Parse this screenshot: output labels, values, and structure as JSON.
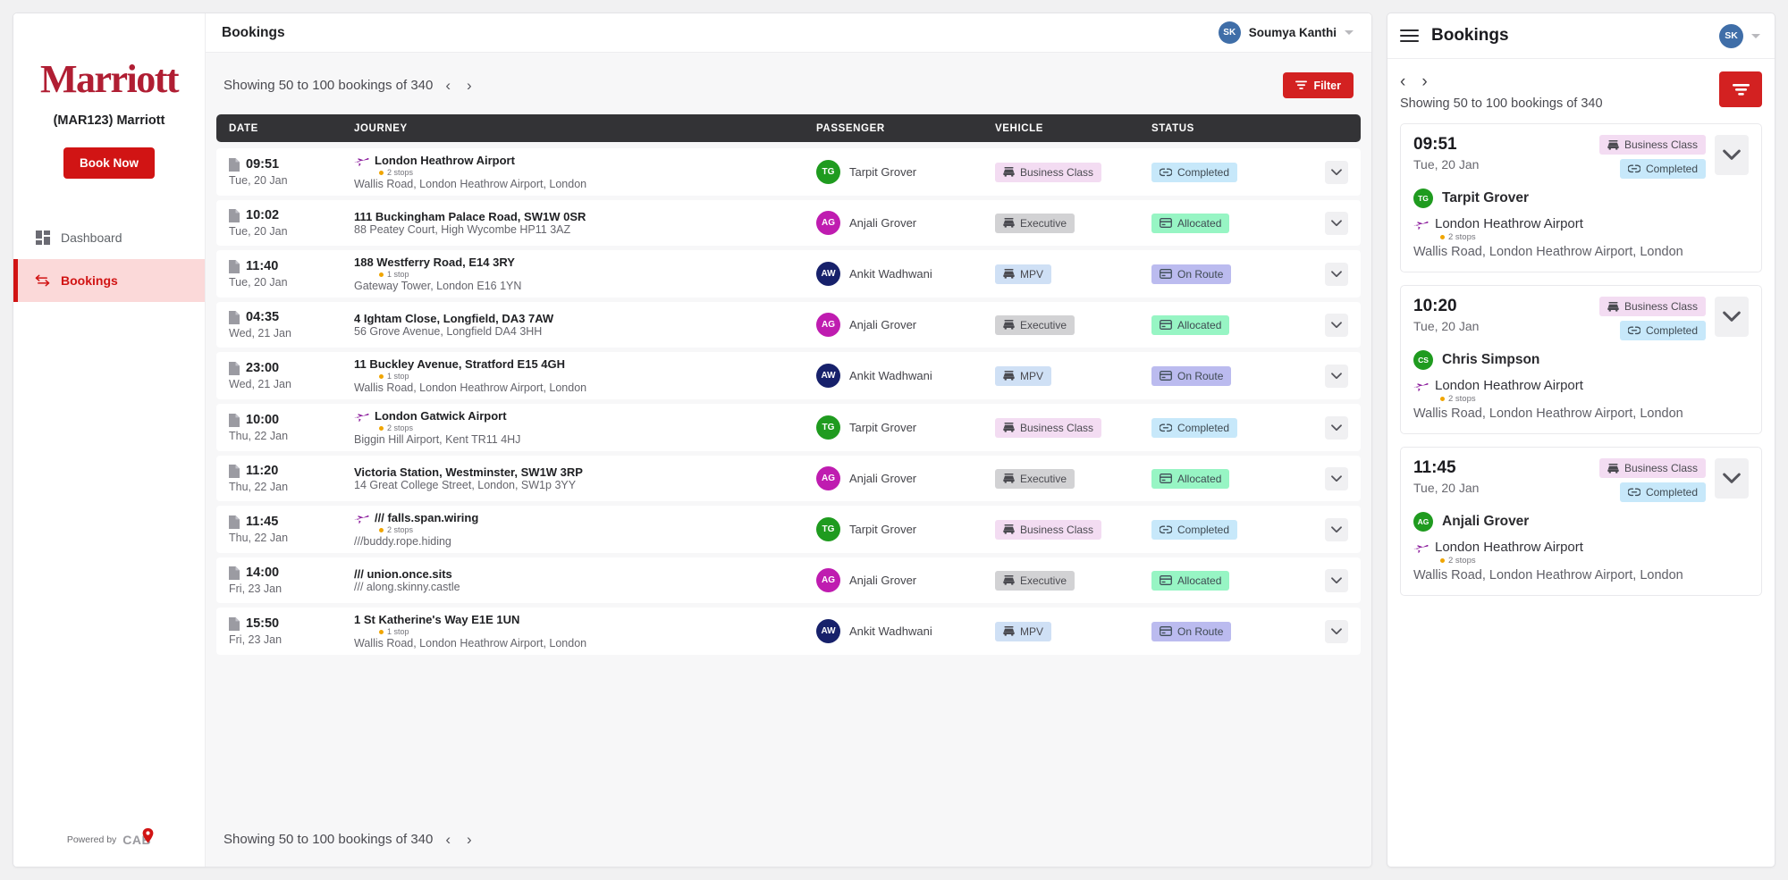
{
  "sidebar": {
    "logo_text": "Marriott",
    "company": "(MAR123) Marriott",
    "book_now": "Book Now",
    "items": [
      {
        "label": "Dashboard",
        "icon": "dashboard-icon",
        "active": false
      },
      {
        "label": "Bookings",
        "icon": "transfer-arrows-icon",
        "active": true
      }
    ],
    "powered_by": "Powered by",
    "powered_brand": "CAB"
  },
  "topbar": {
    "title": "Bookings",
    "user_initials": "SK",
    "user_name": "Soumya Kanthi"
  },
  "pagination": {
    "showing": "Showing 50 to 100 bookings of 340",
    "prev": "‹",
    "next": "›"
  },
  "filter": {
    "label": "Filter",
    "icon": "filter-icon"
  },
  "table": {
    "columns": [
      "DATE",
      "JOURNEY",
      "PASSENGER",
      "VEHICLE",
      "STATUS"
    ],
    "rows": [
      {
        "time": "09:51",
        "day": "Tue, 20 Jan",
        "from": "London Heathrow Airport",
        "from_icon": "plane-icon",
        "stops": "2 stops",
        "to": "Wallis Road, London Heathrow Airport, London",
        "passenger": "Tarpit Grover",
        "initials": "TG",
        "avatar_color": "#1f9b1f",
        "vehicle": "Business Class",
        "vehicle_bg": "#f3dcf2",
        "vehicle_fg": "#4a4a50",
        "status": "Completed",
        "status_bg": "#c7e8fa",
        "status_fg": "#3f4a52",
        "status_icon": "link-icon"
      },
      {
        "time": "10:02",
        "day": "Tue, 20 Jan",
        "from": "111 Buckingham Palace Road, SW1W 0SR",
        "from_icon": "",
        "stops": "",
        "to": "88 Peatey Court, High Wycombe HP11 3AZ",
        "passenger": "Anjali Grover",
        "initials": "AG",
        "avatar_color": "#bf1cb0",
        "vehicle": "Executive",
        "vehicle_bg": "#d2d2d4",
        "vehicle_fg": "#4a4a50",
        "status": "Allocated",
        "status_bg": "#97f5c4",
        "status_fg": "#3f4a52",
        "status_icon": "card-icon"
      },
      {
        "time": "11:40",
        "day": "Tue, 20 Jan",
        "from": "188 Westferry Road, E14 3RY",
        "from_icon": "",
        "stops": "1 stop",
        "to": "Gateway Tower, London E16 1YN",
        "passenger": "Ankit Wadhwani",
        "initials": "AW",
        "avatar_color": "#17216b",
        "vehicle": "MPV",
        "vehicle_bg": "#cfe0f5",
        "vehicle_fg": "#4a4a50",
        "status": "On Route",
        "status_bg": "#bbbbef",
        "status_fg": "#3f4a52",
        "status_icon": "card-icon"
      },
      {
        "time": "04:35",
        "day": "Wed, 21 Jan",
        "from": "4 Ightam Close, Longfield, DA3 7AW",
        "from_icon": "",
        "stops": "",
        "to": "56 Grove Avenue, Longfield DA4 3HH",
        "passenger": "Anjali Grover",
        "initials": "AG",
        "avatar_color": "#bf1cb0",
        "vehicle": "Executive",
        "vehicle_bg": "#d2d2d4",
        "vehicle_fg": "#4a4a50",
        "status": "Allocated",
        "status_bg": "#97f5c4",
        "status_fg": "#3f4a52",
        "status_icon": "card-icon"
      },
      {
        "time": "23:00",
        "day": "Wed, 21 Jan",
        "from": "11 Buckley Avenue, Stratford E15 4GH",
        "from_icon": "",
        "stops": "1 stop",
        "to": "Wallis Road, London Heathrow Airport, London",
        "passenger": "Ankit Wadhwani",
        "initials": "AW",
        "avatar_color": "#17216b",
        "vehicle": "MPV",
        "vehicle_bg": "#cfe0f5",
        "vehicle_fg": "#4a4a50",
        "status": "On Route",
        "status_bg": "#bbbbef",
        "status_fg": "#3f4a52",
        "status_icon": "card-icon"
      },
      {
        "time": "10:00",
        "day": "Thu, 22 Jan",
        "from": "London Gatwick Airport",
        "from_icon": "plane-icon",
        "stops": "2 stops",
        "to": "Biggin Hill Airport, Kent TR11 4HJ",
        "passenger": "Tarpit Grover",
        "initials": "TG",
        "avatar_color": "#1f9b1f",
        "vehicle": "Business Class",
        "vehicle_bg": "#f3dcf2",
        "vehicle_fg": "#4a4a50",
        "status": "Completed",
        "status_bg": "#c7e8fa",
        "status_fg": "#3f4a52",
        "status_icon": "link-icon"
      },
      {
        "time": "11:20",
        "day": "Thu, 22 Jan",
        "from": "Victoria Station, Westminster, SW1W 3RP",
        "from_icon": "",
        "stops": "",
        "to": "14 Great College Street, London, SW1p 3YY",
        "passenger": "Anjali Grover",
        "initials": "AG",
        "avatar_color": "#bf1cb0",
        "vehicle": "Executive",
        "vehicle_bg": "#d2d2d4",
        "vehicle_fg": "#4a4a50",
        "status": "Allocated",
        "status_bg": "#97f5c4",
        "status_fg": "#3f4a52",
        "status_icon": "card-icon"
      },
      {
        "time": "11:45",
        "day": "Thu, 22 Jan",
        "from": "/// falls.span.wiring",
        "from_icon": "plane-icon",
        "stops": "2 stops",
        "to": "///buddy.rope.hiding",
        "passenger": "Tarpit Grover",
        "initials": "TG",
        "avatar_color": "#1f9b1f",
        "vehicle": "Business Class",
        "vehicle_bg": "#f3dcf2",
        "vehicle_fg": "#4a4a50",
        "status": "Completed",
        "status_bg": "#c7e8fa",
        "status_fg": "#3f4a52",
        "status_icon": "link-icon"
      },
      {
        "time": "14:00",
        "day": "Fri, 23 Jan",
        "from": "/// union.once.sits",
        "from_icon": "",
        "stops": "",
        "to": "/// along.skinny.castle",
        "passenger": "Anjali Grover",
        "initials": "AG",
        "avatar_color": "#bf1cb0",
        "vehicle": "Executive",
        "vehicle_bg": "#d2d2d4",
        "vehicle_fg": "#4a4a50",
        "status": "Allocated",
        "status_bg": "#97f5c4",
        "status_fg": "#3f4a52",
        "status_icon": "card-icon"
      },
      {
        "time": "15:50",
        "day": "Fri, 23 Jan",
        "from": "1 St Katherine's Way E1E 1UN",
        "from_icon": "",
        "stops": "1 stop",
        "to": "Wallis Road, London Heathrow Airport, London",
        "passenger": "Ankit Wadhwani",
        "initials": "AW",
        "avatar_color": "#17216b",
        "vehicle": "MPV",
        "vehicle_bg": "#cfe0f5",
        "vehicle_fg": "#4a4a50",
        "status": "On Route",
        "status_bg": "#bbbbef",
        "status_fg": "#3f4a52",
        "status_icon": "card-icon"
      }
    ]
  },
  "mobile": {
    "title": "Bookings",
    "user_initials": "SK",
    "showing": "Showing 50 to 100 bookings of 340",
    "prev": "‹",
    "next": "›",
    "cards": [
      {
        "time": "09:51",
        "day": "Tue, 20 Jan",
        "vehicle": "Business Class",
        "status": "Completed",
        "passenger": "Tarpit Grover",
        "initials": "TG",
        "avatar_color": "#1f9b1f",
        "from": "London Heathrow Airport",
        "stops": "2 stops",
        "to": "Wallis Road, London Heathrow Airport, London"
      },
      {
        "time": "10:20",
        "day": "Tue, 20 Jan",
        "vehicle": "Business Class",
        "status": "Completed",
        "passenger": "Chris Simpson",
        "initials": "CS",
        "avatar_color": "#1f9b1f",
        "from": "London Heathrow Airport",
        "stops": "2 stops",
        "to": "Wallis Road, London Heathrow Airport, London"
      },
      {
        "time": "11:45",
        "day": "Tue, 20 Jan",
        "vehicle": "Business Class",
        "status": "Completed",
        "passenger": "Anjali Grover",
        "initials": "AG",
        "avatar_color": "#1f9b1f",
        "from": "London Heathrow Airport",
        "stops": "2 stops",
        "to": "Wallis Road, London Heathrow Airport, London"
      }
    ]
  },
  "colors": {
    "brand_red": "#d11414",
    "filter_red": "#d32121",
    "header_dark": "#333336",
    "plane_purple": "#8a1a9b"
  }
}
